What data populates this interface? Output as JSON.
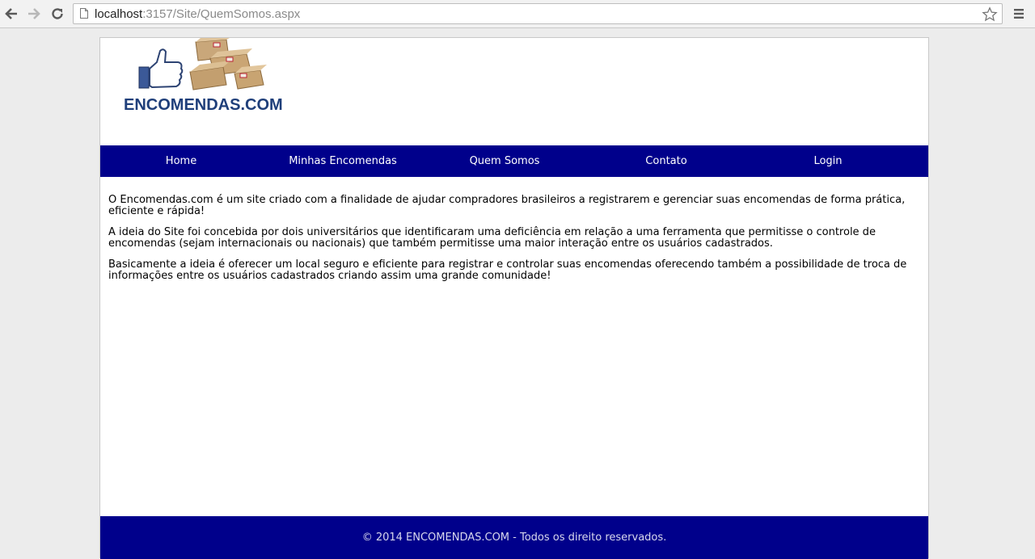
{
  "browser": {
    "url_host": "localhost",
    "url_rest": ":3157/Site/QuemSomos.aspx",
    "icons": [
      "back-arrow-icon",
      "forward-arrow-icon",
      "reload-icon",
      "page-icon",
      "bookmark-star-icon",
      "menu-icon"
    ]
  },
  "site": {
    "logo_text": "ENCOMENDAS.COM",
    "nav": [
      {
        "label": "Home"
      },
      {
        "label": "Minhas Encomendas"
      },
      {
        "label": "Quem Somos"
      },
      {
        "label": "Contato"
      },
      {
        "label": "Login"
      }
    ],
    "paragraphs": [
      "O Encomendas.com é um site criado com a finalidade de ajudar compradores brasileiros a registrarem e gerenciar suas encomendas de forma prática, eficiente e rápida!",
      "A ideia do Site foi concebida por dois universitários que identificaram uma deficiência em relação a uma ferramenta que permitisse o controle de encomendas (sejam internacionais ou nacionais) que também permitisse uma maior interação entre os usuários cadastrados.",
      "Basicamente a ideia é oferecer um local seguro e eficiente para registrar e controlar suas encomendas oferecendo também a possibilidade de troca de informações entre os usuários cadastrados criando assim uma grande comunidade!"
    ],
    "footer": "© 2014 ENCOMENDAS.COM - Todos os direito reservados."
  },
  "colors": {
    "nav_background": "#00008b",
    "logo_text": "#1f3f7a",
    "page_background": "#ececec"
  }
}
